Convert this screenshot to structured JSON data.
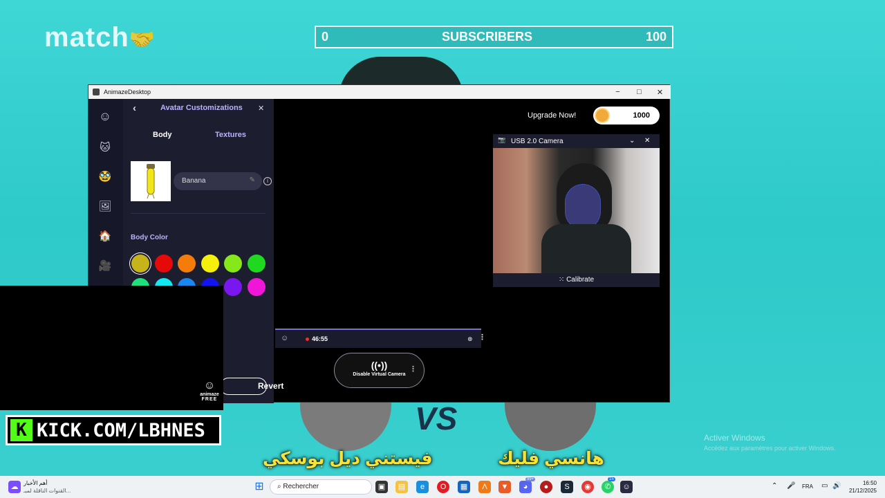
{
  "overlay": {
    "logo": "match",
    "logo_icon": "handshake-icon",
    "sub_left": "0",
    "sub_title": "SUBSCRIBERS",
    "sub_right": "100",
    "kick_text": "KICK.COM/LBHNES",
    "name_left": "فيستني ديل بوسكي",
    "name_right": "هانسي فليك",
    "vs": "VS",
    "activate_title": "Activer Windows",
    "activate_sub": "Accédez aux paramètres pour activer Windows.",
    "animaze_badge": "animaze",
    "animaze_free": "FREE"
  },
  "window": {
    "title": "AnimazeDesktop",
    "min": "−",
    "max": "□",
    "close": "✕"
  },
  "panel": {
    "back": "‹",
    "title": "Avatar Customizations",
    "close": "✕",
    "tab_body": "Body",
    "tab_textures": "Textures",
    "avatar_name": "Banana",
    "edit_icon": "✎",
    "info_icon": "i",
    "body_color_label": "Body Color",
    "colors": [
      "#c7b41a",
      "#e50909",
      "#f57c0b",
      "#f5ef0e",
      "#86e81a",
      "#1fd81f",
      "#1fe07a",
      "#12e8f0",
      "#1a86f0",
      "#1414f0",
      "#7a16f0",
      "#f016d8"
    ],
    "revert": "Revert"
  },
  "main": {
    "upgrade": "Upgrade Now!",
    "coins": "1000",
    "camera_title": "USB 2.0 Camera",
    "calibrate": "Calibrate",
    "timer": "46:55",
    "virtual_cam": "Disable Virtual Camera"
  },
  "taskbar": {
    "news_title": "أهم الأخبار",
    "news_sub": "القنوات الناقلة لمبـ...",
    "search": "Rechercher",
    "lang": "FRA",
    "time": "16:50",
    "date": "21/12/2025",
    "badge1": "99+",
    "badge2": "15"
  }
}
